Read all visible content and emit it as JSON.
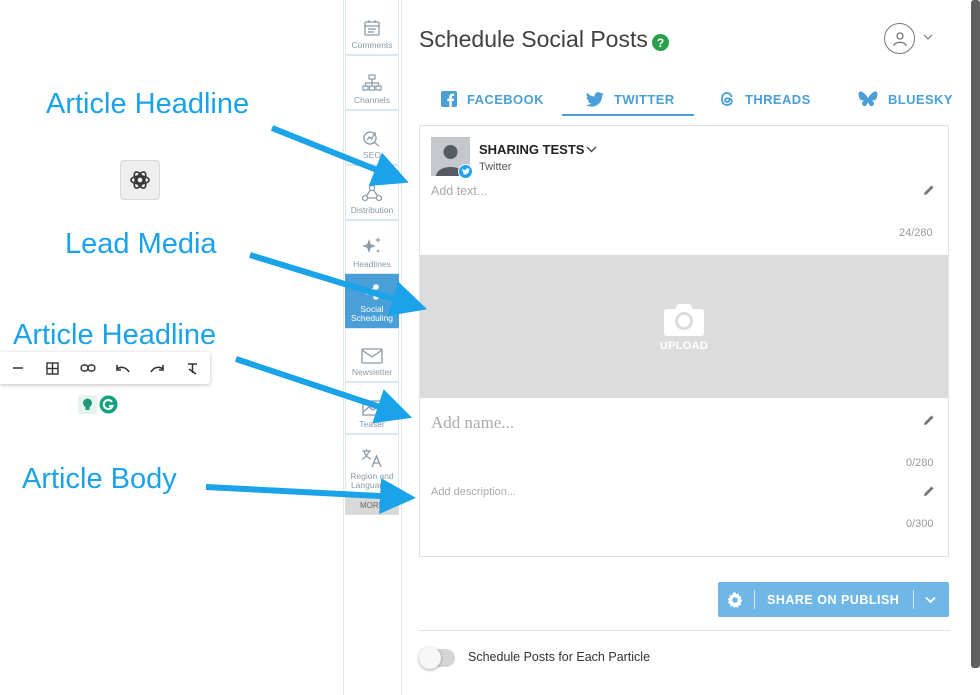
{
  "sidebar": {
    "items": [
      {
        "label": "Comments",
        "icon": "calendar-icon"
      },
      {
        "label": "Channels",
        "icon": "sitemap-icon"
      },
      {
        "label": "SEO",
        "icon": "chart-search-icon"
      },
      {
        "label": "Distribution",
        "icon": "distribution-icon"
      },
      {
        "label": "Headlines",
        "icon": "sparkle-icon"
      },
      {
        "label": "Social Scheduling",
        "icon": "share-icon",
        "active": true
      },
      {
        "label": "Newsletter",
        "icon": "mail-icon"
      },
      {
        "label": "Teaser",
        "icon": "image-icon"
      },
      {
        "label": "Region and Languages",
        "icon": "translate-icon"
      }
    ],
    "more_label": "MORE"
  },
  "header": {
    "title": "Schedule Social Posts",
    "help_glyph": "?"
  },
  "tabs": [
    {
      "label": "FACEBOOK",
      "icon": "facebook-icon"
    },
    {
      "label": "TWITTER",
      "icon": "twitter-icon",
      "active": true
    },
    {
      "label": "THREADS",
      "icon": "threads-icon"
    },
    {
      "label": "BLUESKY",
      "icon": "bluesky-icon"
    }
  ],
  "post": {
    "account_name": "SHARING TESTS",
    "account_network": "Twitter",
    "text_placeholder": "Add text...",
    "text_count": "24/280",
    "upload_label": "UPLOAD",
    "name_placeholder": "Add name...",
    "name_count": "0/280",
    "description_placeholder": "Add description...",
    "description_count": "0/300"
  },
  "share_button_label": "SHARE ON PUBLISH",
  "schedule_toggle_label": "Schedule Posts for Each Particle",
  "annotations": {
    "a1": "Article Headline",
    "a2": "Lead Media",
    "a3": "Article Headline",
    "a4": "Article Body"
  },
  "colors": {
    "accent": "#4a9fd8",
    "annotation": "#1aa3e8",
    "help_green": "#2aa04a",
    "share_button": "#6fb7e6"
  }
}
